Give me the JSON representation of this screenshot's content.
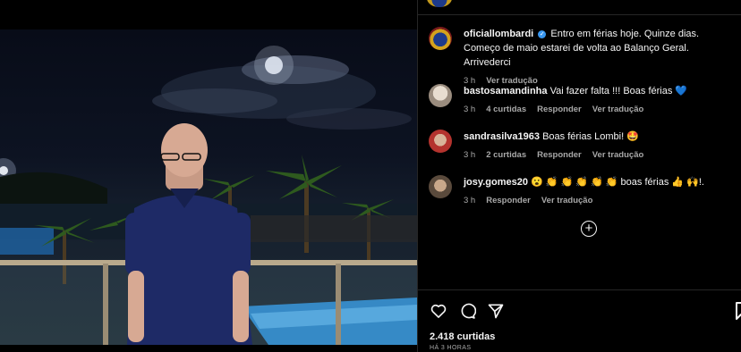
{
  "post": {
    "author": "oficiallombardi",
    "caption": "Entro em férias hoje. Quinze dias. Começo de maio estarei de volta ao Balanço Geral. Arrivederci",
    "time": "3 h",
    "see_translation": "Ver tradução",
    "likes": "2.418 curtidas",
    "posted_ago": "HÁ 3 HORAS"
  },
  "comments": [
    {
      "user": "bastosamandinha",
      "text": "Vai fazer falta !!! Boas férias 💙",
      "time": "3 h",
      "likes": "4 curtidas",
      "reply": "Responder",
      "translate": "Ver tradução"
    },
    {
      "user": "sandrasilva1963",
      "text": "Boas férias Lombi! 🤩",
      "time": "3 h",
      "likes": "2 curtidas",
      "reply": "Responder",
      "translate": "Ver tradução"
    },
    {
      "user": "josy.gomes20",
      "text": "😮 👏 👏 👏 👏 👏 boas férias 👍 🙌!.",
      "time": "3 h",
      "reply": "Responder",
      "translate": "Ver tradução"
    }
  ],
  "icons": {
    "like": "heart-icon",
    "comment": "comment-icon",
    "share": "paper-plane-icon",
    "save": "bookmark-icon",
    "more": "plus-circle-icon",
    "verified": "verified-badge-icon"
  },
  "colors": {
    "background": "#000000",
    "text": "#f5f5f5",
    "muted": "#a8a8a8",
    "verified": "#3897f0",
    "divider": "#262626"
  }
}
